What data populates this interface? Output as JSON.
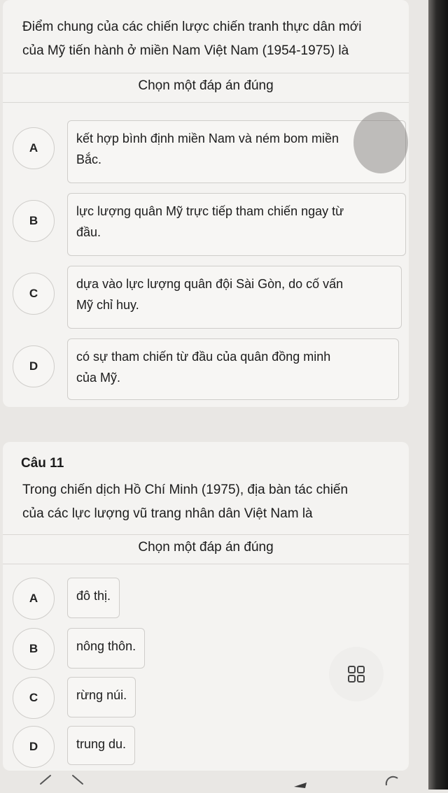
{
  "question10": {
    "text_line1": "Điểm chung của các chiến lược chiến tranh thực dân mới",
    "text_line2": "của Mỹ tiến hành ở miền Nam Việt Nam (1954-1975) là",
    "instruction": "Chọn một đáp án đúng",
    "options": [
      {
        "letter": "A",
        "line1": "kết hợp bình định miền Nam và ném bom miền",
        "line2": "Bắc."
      },
      {
        "letter": "B",
        "line1": "lực lượng quân Mỹ trực tiếp tham chiến ngay từ",
        "line2": "đầu."
      },
      {
        "letter": "C",
        "line1": "dựa vào lực lượng quân đội Sài Gòn, do cố vấn",
        "line2": "Mỹ chỉ huy."
      },
      {
        "letter": "D",
        "line1": "có sự tham chiến từ đầu của quân đồng minh",
        "line2": "của Mỹ."
      }
    ]
  },
  "question11": {
    "number": "Câu 11",
    "text_line1": "Trong chiến dịch Hồ Chí Minh (1975), địa bàn tác chiến",
    "text_line2": "của các lực lượng vũ trang nhân dân Việt Nam là",
    "instruction": "Chọn một đáp án đúng",
    "options": [
      {
        "letter": "A",
        "text": "đô thị."
      },
      {
        "letter": "B",
        "text": "nông thôn."
      },
      {
        "letter": "C",
        "text": "rừng núi."
      },
      {
        "letter": "D",
        "text": "trung du."
      }
    ]
  },
  "icons": {
    "grid": "grid-icon",
    "back": "chevron-left-icon",
    "forward": "chevron-right-icon",
    "rotate": "rotate-icon"
  },
  "colors": {
    "background": "#e9e7e4",
    "card": "#f4f3f1",
    "border": "#cfcdca"
  }
}
